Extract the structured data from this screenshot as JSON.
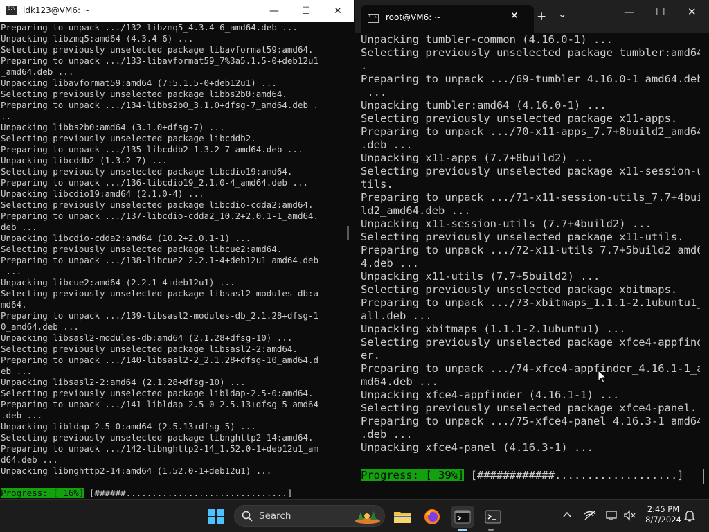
{
  "left_window": {
    "title": "idk123@VM6: ~",
    "controls": {
      "minimize": "—",
      "maximize": "☐",
      "close": "✕"
    },
    "lines": [
      "Preparing to unpack .../132-libzmq5_4.3.4-6_amd64.deb ...",
      "Unpacking libzmq5:amd64 (4.3.4-6) ...",
      "Selecting previously unselected package libavformat59:amd64.",
      "Preparing to unpack .../133-libavformat59_7%3a5.1.5-0+deb12u1",
      "_amd64.deb ...",
      "Unpacking libavformat59:amd64 (7:5.1.5-0+deb12u1) ...",
      "Selecting previously unselected package libbs2b0:amd64.",
      "Preparing to unpack .../134-libbs2b0_3.1.0+dfsg-7_amd64.deb .",
      "..",
      "Unpacking libbs2b0:amd64 (3.1.0+dfsg-7) ...",
      "Selecting previously unselected package libcddb2.",
      "Preparing to unpack .../135-libcddb2_1.3.2-7_amd64.deb ...",
      "Unpacking libcddb2 (1.3.2-7) ...",
      "Selecting previously unselected package libcdio19:amd64.",
      "Preparing to unpack .../136-libcdio19_2.1.0-4_amd64.deb ...",
      "Unpacking libcdio19:amd64 (2.1.0-4) ...",
      "Selecting previously unselected package libcdio-cdda2:amd64.",
      "Preparing to unpack .../137-libcdio-cdda2_10.2+2.0.1-1_amd64.",
      "deb ...",
      "Unpacking libcdio-cdda2:amd64 (10.2+2.0.1-1) ...",
      "Selecting previously unselected package libcue2:amd64.",
      "Preparing to unpack .../138-libcue2_2.2.1-4+deb12u1_amd64.deb",
      " ...",
      "Unpacking libcue2:amd64 (2.2.1-4+deb12u1) ...",
      "Selecting previously unselected package libsasl2-modules-db:a",
      "md64.",
      "Preparing to unpack .../139-libsasl2-modules-db_2.1.28+dfsg-1",
      "0_amd64.deb ...",
      "Unpacking libsasl2-modules-db:amd64 (2.1.28+dfsg-10) ...",
      "Selecting previously unselected package libsasl2-2:amd64.",
      "Preparing to unpack .../140-libsasl2-2_2.1.28+dfsg-10_amd64.d",
      "eb ...",
      "Unpacking libsasl2-2:amd64 (2.1.28+dfsg-10) ...",
      "Selecting previously unselected package libldap-2.5-0:amd64.",
      "Preparing to unpack .../141-libldap-2.5-0_2.5.13+dfsg-5_amd64",
      ".deb ...",
      "Unpacking libldap-2.5-0:amd64 (2.5.13+dfsg-5) ...",
      "Selecting previously unselected package libnghttp2-14:amd64.",
      "Preparing to unpack .../142-libnghttp2-14_1.52.0-1+deb12u1_am",
      "d64.deb ...",
      "Unpacking libnghttp2-14:amd64 (1.52.0-1+deb12u1) ..."
    ],
    "progress_label": "Progress: [ 16%]",
    "progress_bar": "[######...............................]",
    "progress_value": 0.16
  },
  "right_window": {
    "tab_title": "root@VM6: ~",
    "tab_close": "✕",
    "new_tab": "+",
    "dropdown": "⌄",
    "controls": {
      "minimize": "—",
      "maximize": "☐",
      "close": "✕"
    },
    "lines": [
      "Unpacking tumbler-common (4.16.0-1) ...",
      "Selecting previously unselected package tumbler:amd64",
      ".",
      "Preparing to unpack .../69-tumbler_4.16.0-1_amd64.deb",
      " ...",
      "Unpacking tumbler:amd64 (4.16.0-1) ...",
      "Selecting previously unselected package x11-apps.",
      "Preparing to unpack .../70-x11-apps_7.7+8build2_amd64",
      ".deb ...",
      "Unpacking x11-apps (7.7+8build2) ...",
      "Selecting previously unselected package x11-session-u",
      "tils.",
      "Preparing to unpack .../71-x11-session-utils_7.7+4bui",
      "ld2_amd64.deb ...",
      "Unpacking x11-session-utils (7.7+4build2) ...",
      "Selecting previously unselected package x11-utils.",
      "Preparing to unpack .../72-x11-utils_7.7+5build2_amd6",
      "4.deb ...",
      "Unpacking x11-utils (7.7+5build2) ...",
      "Selecting previously unselected package xbitmaps.",
      "Preparing to unpack .../73-xbitmaps_1.1.1-2.1ubuntu1_",
      "all.deb ...",
      "Unpacking xbitmaps (1.1.1-2.1ubuntu1) ...",
      "Selecting previously unselected package xfce4-appfind",
      "er.",
      "Preparing to unpack .../74-xfce4-appfinder_4.16.1-1_a",
      "md64.deb ...",
      "Unpacking xfce4-appfinder (4.16.1-1) ...",
      "Selecting previously unselected package xfce4-panel.",
      "Preparing to unpack .../75-xfce4-panel_4.16.3-1_amd64",
      ".deb ...",
      "Unpacking xfce4-panel (4.16.3-1) ..."
    ],
    "progress_label": "Progress: [ 39%]",
    "progress_bar": "[############...................]",
    "progress_value": 0.39
  },
  "taskbar": {
    "search_placeholder": "Search",
    "time": "2:45 PM",
    "date": "8/7/2024",
    "icons": [
      "windows-start-icon",
      "search-icon",
      "file-explorer-icon",
      "firefox-icon",
      "terminal-icon",
      "terminal-icon-2",
      "chevron-up-icon",
      "network-icon",
      "display-icon",
      "volume-icon",
      "notification-bell-icon"
    ],
    "accent_color": "#13a10e"
  }
}
